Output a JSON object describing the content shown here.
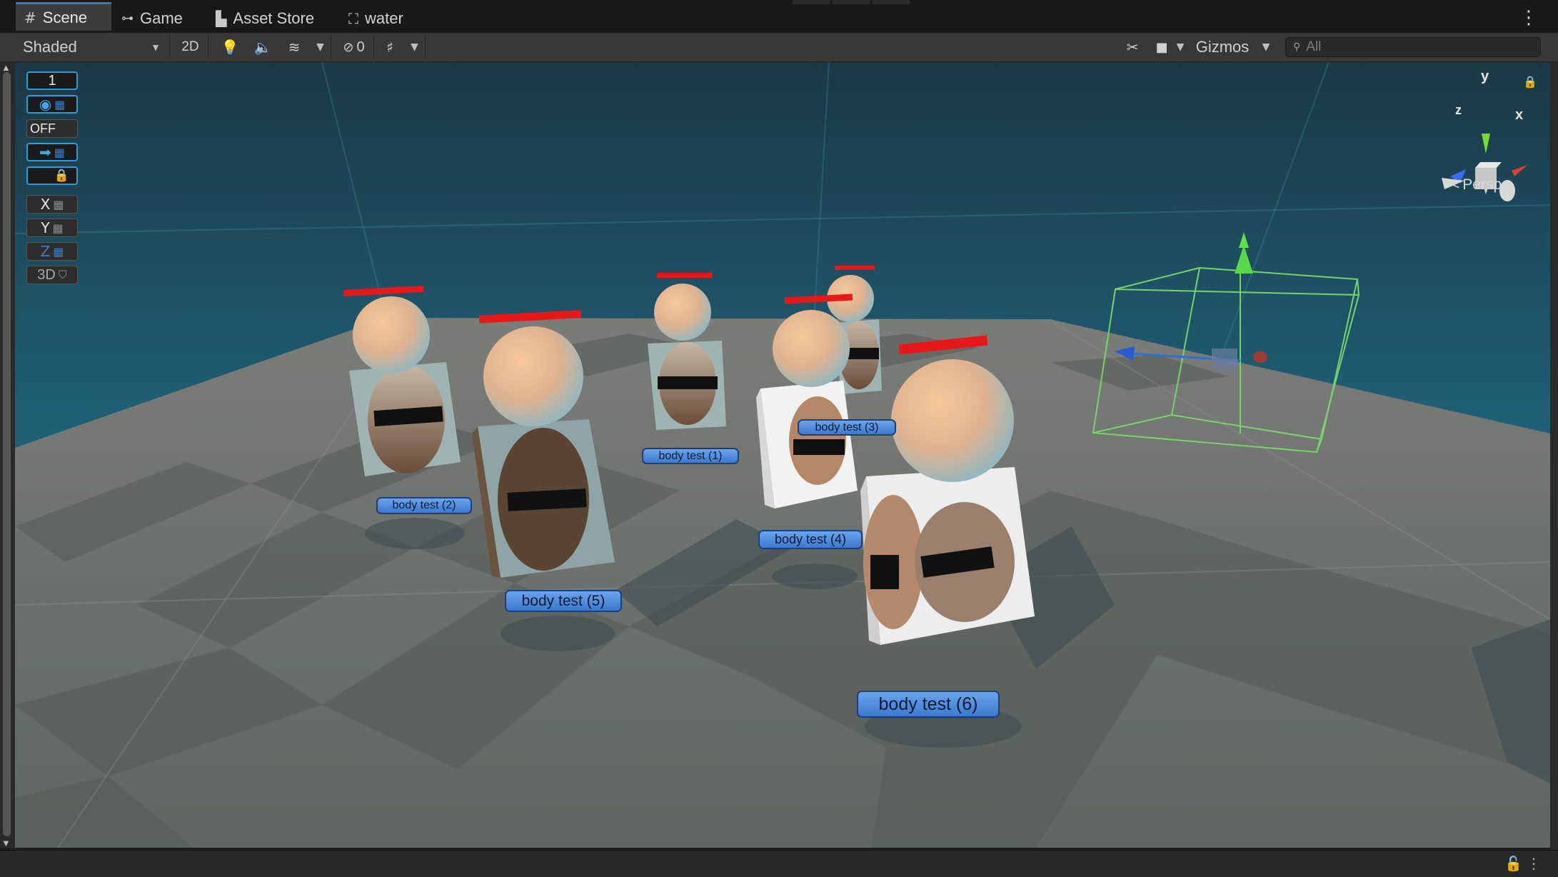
{
  "tabs": [
    {
      "label": "Scene",
      "icon": "scene-grid-icon",
      "glyph": "#",
      "active": true
    },
    {
      "label": "Game",
      "icon": "gamepad-icon",
      "glyph": "🎮",
      "active": false
    },
    {
      "label": "Asset Store",
      "icon": "shopping-bag-icon",
      "glyph": "🛍",
      "active": false
    },
    {
      "label": "water",
      "icon": "lock-robot-icon",
      "glyph": "⛶",
      "active": false
    }
  ],
  "toolbar": {
    "draw_mode": "Shaded",
    "mode_2d": "2D",
    "hidden_count": "0",
    "gizmos": "Gizmos",
    "search_placeholder": "All",
    "search_icon": "search-icon"
  },
  "overlay_tools": {
    "count_value": "1",
    "off_label": "OFF",
    "x_label": "X",
    "y_label": "Y",
    "z_label": "Z",
    "threed_label": "3D"
  },
  "orientation_gizmo": {
    "x": "x",
    "y": "y",
    "z": "z",
    "projection": "Persp"
  },
  "scene_objects": [
    {
      "name": "body test (2)"
    },
    {
      "name": "body test (5)"
    },
    {
      "name": "body test (1)"
    },
    {
      "name": "body test (4)"
    },
    {
      "name": "body test (3)"
    },
    {
      "name": "body test (6)"
    }
  ],
  "colors": {
    "tab_accent": "#3a79bb",
    "sky_top": "#1c3d4c",
    "sea": "#1f7089",
    "floor": "#6f7470",
    "health_bar": "#e8181a",
    "label_fill": "#5a97e6",
    "bounds_gizmo": "#78d26a"
  }
}
